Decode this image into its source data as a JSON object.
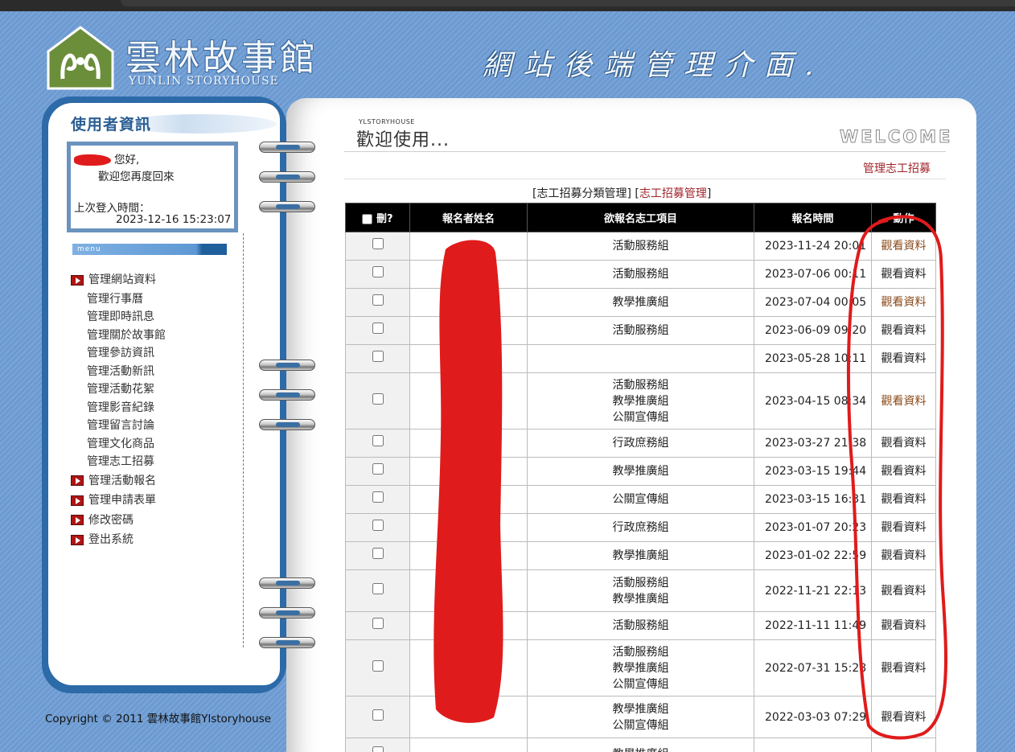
{
  "header": {
    "logo_cn": "雲林故事館",
    "logo_en": "YUNLIN STORYHOUSE",
    "slogan": "網站後端管理介面."
  },
  "sidebar": {
    "title": "使用者資訊",
    "greeting": "您好,",
    "welcome_back": "歡迎您再度回來",
    "last_login_label": "上次登入時間：",
    "last_login_time": "2023-12-16 15:23:07",
    "menu_label": "menu",
    "sections": [
      {
        "label": "管理網站資料",
        "items": [
          "管理行事曆",
          "管理即時訊息",
          "管理關於故事館",
          "管理參訪資訊",
          "管理活動新訊",
          "管理活動花絮",
          "管理影音紀錄",
          "管理留言討論",
          "管理文化商品",
          "管理志工招募"
        ]
      },
      {
        "label": "管理活動報名",
        "items": []
      },
      {
        "label": "管理申請表單",
        "items": []
      },
      {
        "label": "修改密碼",
        "items": []
      },
      {
        "label": "登出系統",
        "items": []
      }
    ],
    "copyright": "Copyright © 2011 雲林故事館Ylstoryhouse"
  },
  "main": {
    "site_small": "YLSTORYHOUSE",
    "title": "歡迎使用...",
    "welcome": "WELCOME",
    "section_link": "管理志工招募",
    "nav": {
      "open": "[",
      "link1": "志工招募分類管理",
      "mid": "] [",
      "link2": "志工招募管理",
      "close": "]"
    },
    "table": {
      "headers": {
        "delete": "刪?",
        "name": "報名者姓名",
        "project": "欲報名志工項目",
        "time": "報名時間",
        "action": "動作"
      },
      "rows": [
        {
          "project": [
            "活動服務組"
          ],
          "time": "2023-11-24 20:01",
          "action": "觀看資料",
          "action_color": "brown"
        },
        {
          "project": [
            "活動服務組"
          ],
          "time": "2023-07-06 00:11",
          "action": "觀看資料",
          "action_color": "dark"
        },
        {
          "project": [
            "教學推廣組"
          ],
          "time": "2023-07-04 00:05",
          "action": "觀看資料",
          "action_color": "brown"
        },
        {
          "project": [
            "活動服務組"
          ],
          "time": "2023-06-09 09:20",
          "action": "觀看資料",
          "action_color": "dark"
        },
        {
          "project": [],
          "time": "2023-05-28 10:11",
          "action": "觀看資料",
          "action_color": "dark"
        },
        {
          "project": [
            "活動服務組",
            "教學推廣組",
            "公關宣傳組"
          ],
          "time": "2023-04-15 08:34",
          "action": "觀看資料",
          "action_color": "brown"
        },
        {
          "project": [
            "行政庶務組"
          ],
          "time": "2023-03-27 21:38",
          "action": "觀看資料",
          "action_color": "dark"
        },
        {
          "project": [
            "教學推廣組"
          ],
          "time": "2023-03-15 19:44",
          "action": "觀看資料",
          "action_color": "dark"
        },
        {
          "project": [
            "公關宣傳組"
          ],
          "time": "2023-03-15 16:31",
          "action": "觀看資料",
          "action_color": "dark"
        },
        {
          "project": [
            "行政庶務組"
          ],
          "time": "2023-01-07 20:23",
          "action": "觀看資料",
          "action_color": "dark"
        },
        {
          "project": [
            "教學推廣組"
          ],
          "time": "2023-01-02 22:59",
          "action": "觀看資料",
          "action_color": "dark"
        },
        {
          "project": [
            "活動服務組",
            "教學推廣組"
          ],
          "time": "2022-11-21 22:13",
          "action": "觀看資料",
          "action_color": "dark"
        },
        {
          "project": [
            "活動服務組"
          ],
          "time": "2022-11-11 11:49",
          "action": "觀看資料",
          "action_color": "dark"
        },
        {
          "project": [
            "活動服務組",
            "教學推廣組",
            "公關宣傳組"
          ],
          "time": "2022-07-31 15:28",
          "action": "觀看資料",
          "action_color": "dark"
        },
        {
          "project": [
            "教學推廣組",
            "公關宣傳組"
          ],
          "time": "2022-03-03 07:29",
          "action": "觀看資料",
          "action_color": "dark"
        },
        {
          "project": [
            "教學推廣組"
          ],
          "time": "",
          "action": "",
          "action_color": "dark"
        }
      ]
    }
  },
  "colors": {
    "background": "#6f9ed6",
    "panel_border": "#2c6aa8",
    "link_red": "#a0262c",
    "action_brown": "#8a4a1a",
    "annotation_red": "#e01b1b"
  }
}
